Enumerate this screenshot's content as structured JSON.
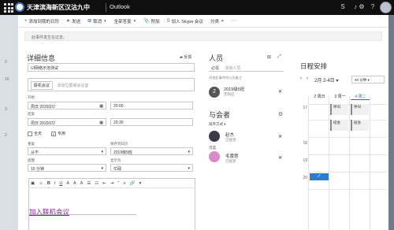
{
  "topbar": {
    "org_name": "天津滨海新区汉沽九中",
    "app_name": "Outlook",
    "icons": [
      "app-launcher-icon",
      "bell-icon",
      "gear-icon",
      "help-icon"
    ]
  },
  "toolbar": {
    "add_online": "添加到我的日历",
    "send": "发送",
    "cancel": "取消",
    "scheduling": "全部答复",
    "attach": "附加",
    "skype": "加入 Skype 会议",
    "categorize": "分类",
    "more": "···"
  },
  "banner": {
    "text": "此事件发生在过去。"
  },
  "details": {
    "heading": "详细信息",
    "feedback": "反馈",
    "title_value": "UI网络示范测试",
    "location_chip": "联机会议",
    "location_placeholder": "添加位置或会议室",
    "start_label": "开始",
    "start_date": "周日 2020/2/2",
    "start_time": "20:00",
    "end_label": "结束",
    "end_date": "周日 2020/2/2",
    "end_time": "20:30",
    "allday_label": "全天",
    "private_label": "专用",
    "repeat_label": "重复",
    "repeat_value": "从不",
    "calendar_label": "保存到日历",
    "calendar_value": "2019级5班",
    "reminder_label": "提醒",
    "reminder_value": "15 分钟",
    "show_as_label": "显示为",
    "show_as_value": "忙碌",
    "body_link": "加入联机会议"
  },
  "people": {
    "heading": "人员",
    "required_label": "必需",
    "required_placeholder": "添加人员",
    "optional_hint": "添加此事件的公司备注",
    "group_name": "2019级5班",
    "group_sub": "无响应",
    "attendees_heading": "与会者",
    "sort_label": "排序方式",
    "organizer_name": "赵杰",
    "organizer_status": "已接受",
    "optional_section": "可选",
    "optional_name": "毛蕾慧",
    "optional_status": "已接受"
  },
  "schedule": {
    "heading": "日程安排",
    "date_range": "2月 2-4日",
    "duration": "30 分钟",
    "days": [
      "2 周日",
      "3 周一",
      "4 周二"
    ],
    "hours": [
      "17",
      "18",
      "19",
      "20"
    ],
    "busy_block1": "呼叫",
    "busy_block2": "班会",
    "busy_block3": "呼叫",
    "busy_block4": "班会"
  }
}
